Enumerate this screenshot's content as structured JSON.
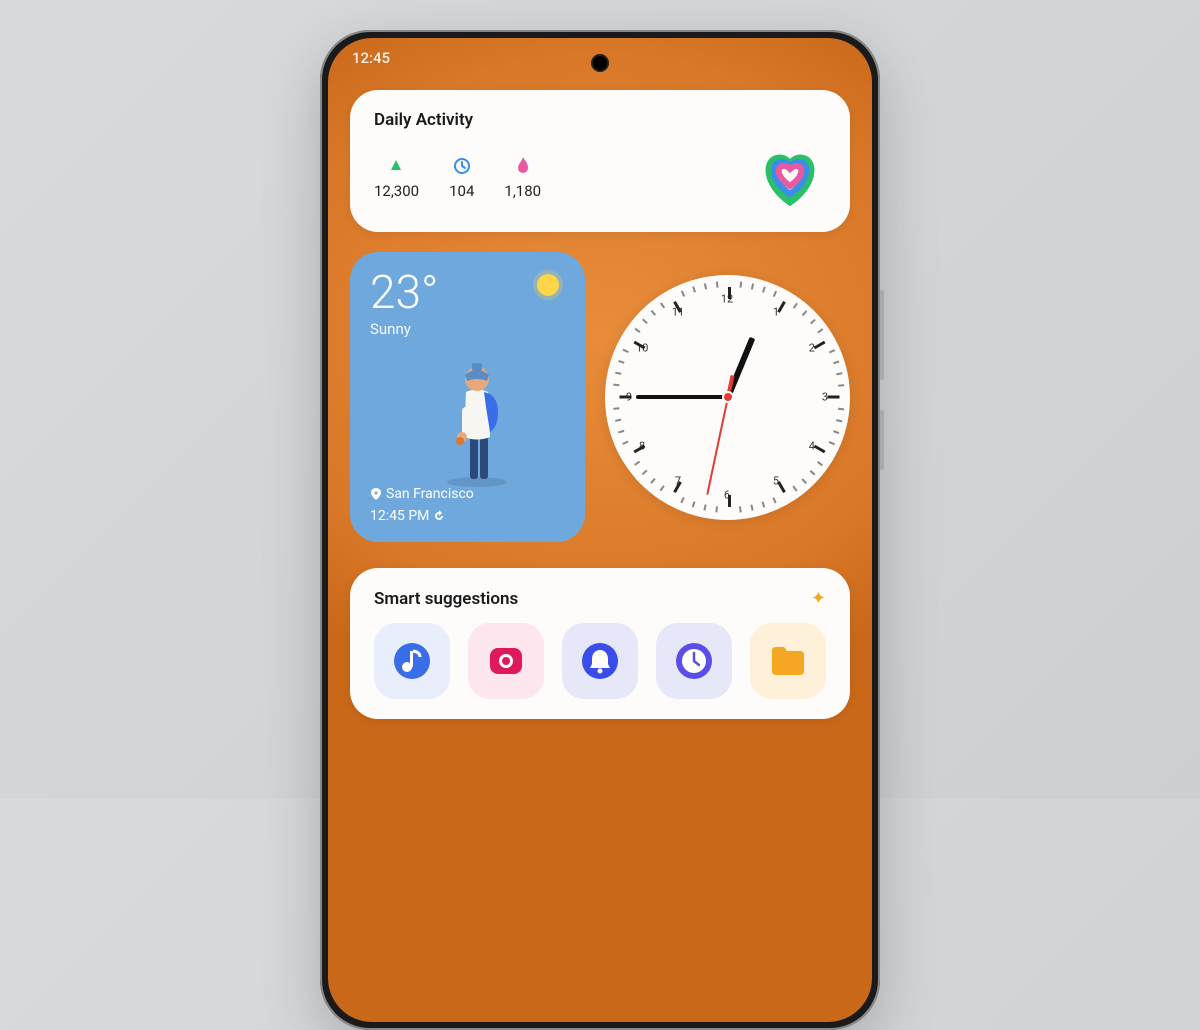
{
  "statusbar": {
    "time": "12:45"
  },
  "daily_activity": {
    "title": "Daily Activity",
    "steps": "12,300",
    "minutes": "104",
    "calories": "1,180"
  },
  "weather": {
    "temp": "23°",
    "condition": "Sunny",
    "location": "San Francisco",
    "time": "12:45 PM"
  },
  "clock": {
    "hour": 12,
    "minute": 45,
    "second": 32
  },
  "suggestions": {
    "title": "Smart suggestions",
    "apps": [
      "music",
      "camera",
      "reminder",
      "clock",
      "files"
    ]
  },
  "colors": {
    "music": "#3a6de8",
    "camera": "#e0195b",
    "bell": "#3a4de8",
    "clock_app": "#5a4de8",
    "folder": "#f5a623"
  }
}
